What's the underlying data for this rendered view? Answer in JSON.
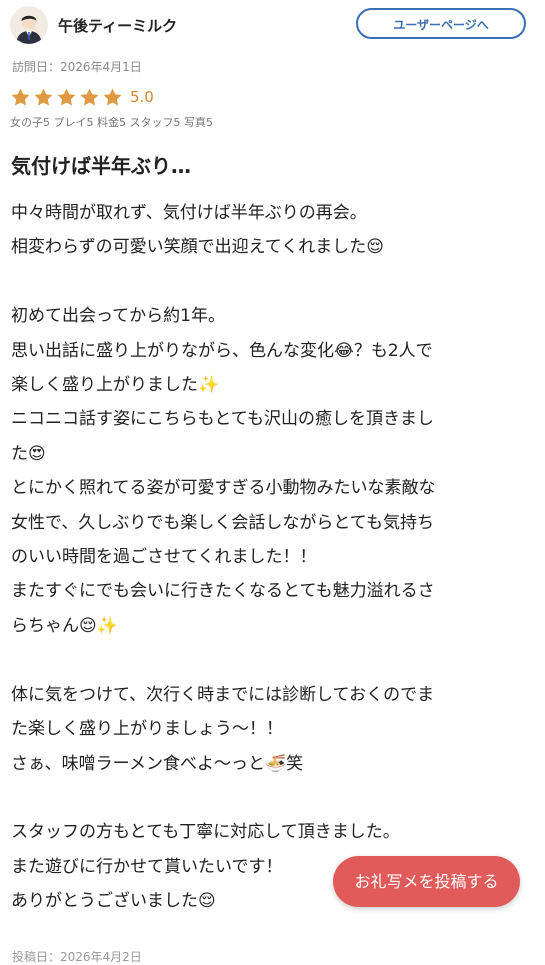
{
  "header": {
    "username": "午後ティーミルク",
    "user_page_button": "ユーザーページへ"
  },
  "review": {
    "visit_date": "訪問日：2026年4月1日",
    "rating_value": 5,
    "rating_text": "5.0",
    "rating_breakdown": "女の子5 プレイ5 料金5 スタッフ5 写真5",
    "title": "気付けば半年ぶり…",
    "body": "中々時間が取れず、気付けば半年ぶりの再会。\n相変わらずの可愛い笑顔で出迎えてくれました😌\n\n初めて出会ってから約1年。\n思い出話に盛り上がりながら、色んな変化😂？も2人で\n楽しく盛り上がりました✨\nニコニコ話す姿にこちらもとても沢山の癒しを頂きまし\nた😍\nとにかく照れてる姿が可愛すぎる小動物みたいな素敵な\n女性で、久しぶりでも楽しく会話しながらとても気持ち\nのいい時間を過ごさせてくれました！！\nまたすぐにでも会いに行きたくなるとても魅力溢れるさ\nらちゃん😌✨\n\n体に気をつけて、次行く時までには診断しておくのでま\nた楽しく盛り上がりましょう〜！！\nさぁ、味噌ラーメン食べよ〜っと🍜笑\n\nスタッフの方もとても丁寧に対応して頂きました。\nまた遊びに行かせて貰いたいです！\nありがとうございました😌",
    "posted_date": "投稿日：2026年4月2日"
  },
  "fab": {
    "label": "お礼写メを投稿する"
  },
  "colors": {
    "accent_blue": "#3a6fb5",
    "star": "#e09a43",
    "fab": "#e15b5b"
  },
  "icons": {
    "avatar": "user-avatar-icon",
    "star": "star-icon"
  }
}
